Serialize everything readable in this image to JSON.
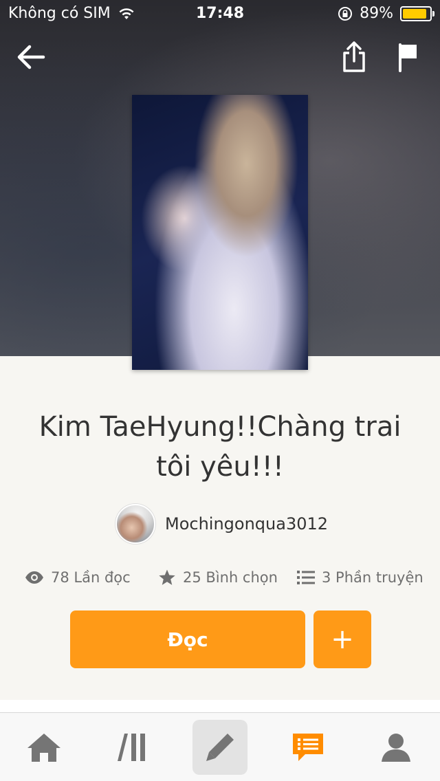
{
  "status_bar": {
    "carrier": "Không có SIM",
    "time": "17:48",
    "battery_percent": "89%",
    "battery_level": 0.89,
    "battery_color": "#ffcc00"
  },
  "story": {
    "title": "Kim TaeHyung!!Chàng trai tôi yêu!!!",
    "author": "Mochingonqua3012",
    "reads": "78 Lần đọc",
    "votes": "25 Bình chọn",
    "parts": "3 Phần truyện"
  },
  "actions": {
    "read_label": "Đọc",
    "add_label": "+"
  },
  "icons": {
    "back": "arrow-left-icon",
    "share": "share-icon",
    "report": "flag-icon",
    "reads": "eye-icon",
    "votes": "star-icon",
    "parts": "list-icon",
    "tabs": [
      "home-icon",
      "library-icon",
      "pencil-icon",
      "messages-icon",
      "profile-icon"
    ]
  },
  "colors": {
    "accent": "#ff9a17",
    "tab_active": "#ff8c00",
    "tab_inactive": "#757575"
  }
}
